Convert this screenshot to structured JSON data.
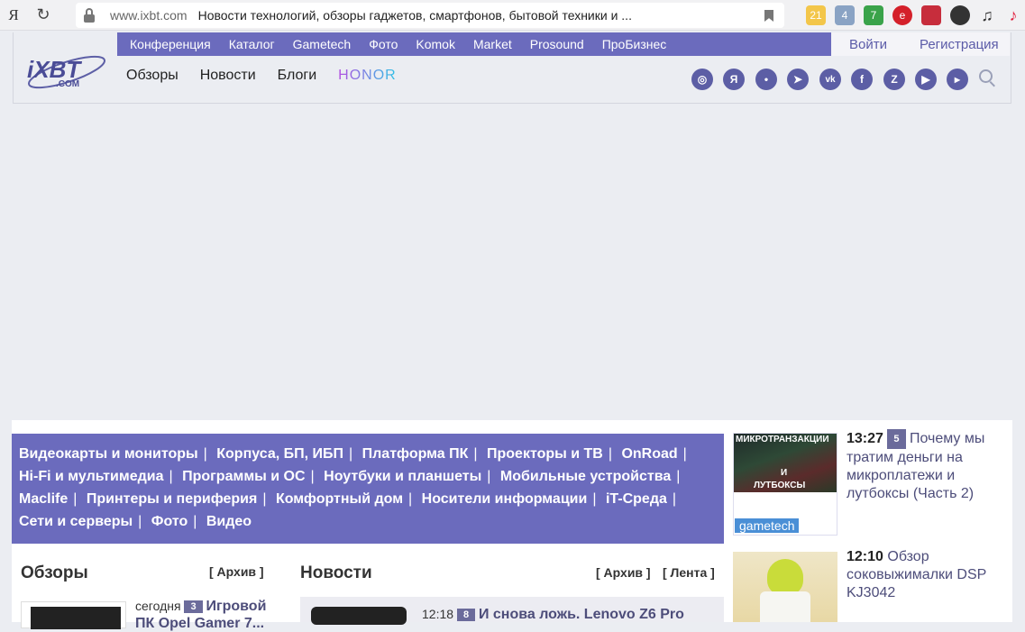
{
  "browser": {
    "logo": "Я",
    "url": "www.ixbt.com",
    "page_title": "Новости технологий, обзоры гаджетов, смартфонов, бытовой техники и ...",
    "ext_badges": [
      "21",
      "4",
      "7"
    ]
  },
  "topnav": {
    "items": [
      "Конференция",
      "Каталог",
      "Gametech",
      "Фото",
      "Komok",
      "Market",
      "Prosound",
      "ПроБизнес"
    ],
    "login": "Войти",
    "register": "Регистрация"
  },
  "logo": {
    "text": "iXBT",
    "sub": ".COM"
  },
  "mainnav": {
    "items": [
      "Обзоры",
      "Новости",
      "Блоги"
    ],
    "brand": "HONOR"
  },
  "social": [
    "instagram-icon",
    "yandex-icon",
    "twitter-icon",
    "telegram-icon",
    "vk-icon",
    "facebook-icon",
    "zen-icon",
    "youtube-icon",
    "live-icon"
  ],
  "categories": [
    "Видеокарты и мониторы",
    "Корпуса, БП, ИБП",
    "Платформа ПК",
    "Проекторы и ТВ",
    "OnRoad",
    "Hi-Fi и мультимедиа",
    "Программы и ОС",
    "Ноутбуки и планшеты",
    "Мобильные устройства",
    "Maclife",
    "Принтеры и периферия",
    "Комфортный дом",
    "Носители информации",
    "iT-Среда",
    "Сети и серверы",
    "Фото",
    "Видео"
  ],
  "reviews": {
    "title": "Обзоры",
    "archive": "[ Архив ]",
    "first": {
      "time": "сегодня",
      "count": "3",
      "title": "Игровой",
      "title2": "ПК Opel Gamer 7..."
    }
  },
  "news": {
    "title": "Новости",
    "archive": "[ Архив ]",
    "feed": "[ Лента ]",
    "first": {
      "time": "12:18",
      "count": "8",
      "title": "И снова ложь. Lenovo Z6 Pro"
    }
  },
  "sidebar": [
    {
      "img_top": "МИКРОТРАНЗАКЦИИ",
      "img_mid": "И",
      "img_bottom": "ЛУТБОКСЫ",
      "tag": "gametech",
      "time": "13:27",
      "count": "5",
      "title": "Почему мы тратим деньги на микроплатежи и лутбоксы (Часть 2)"
    },
    {
      "time": "12:10",
      "title": "Обзор соковыжималки DSP KJ3042"
    }
  ]
}
